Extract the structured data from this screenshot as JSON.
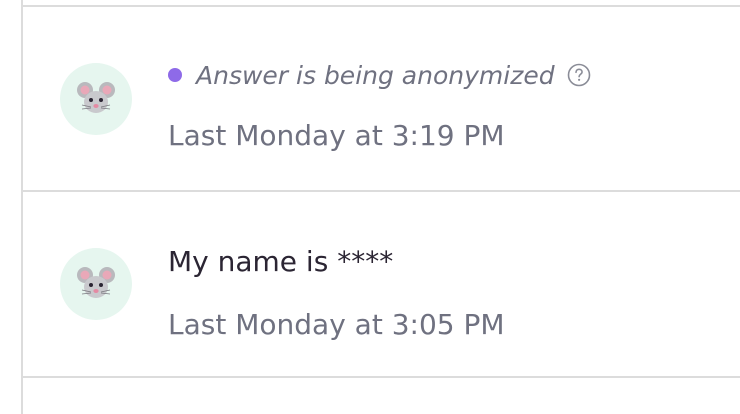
{
  "entries": [
    {
      "status_text": "Answer is being anonymized",
      "timestamp": "Last Monday at 3:19 PM",
      "avatar_icon": "mouse-icon",
      "status_icon": "help-icon"
    },
    {
      "message": "My name is ****",
      "timestamp": "Last Monday at 3:05 PM",
      "avatar_icon": "mouse-icon"
    }
  ],
  "colors": {
    "status_dot": "#8e6ae8",
    "muted_text": "#6f7180",
    "body_text": "#2b2533",
    "avatar_bg": "#e6f6ef",
    "divider": "#dcdcdc"
  }
}
